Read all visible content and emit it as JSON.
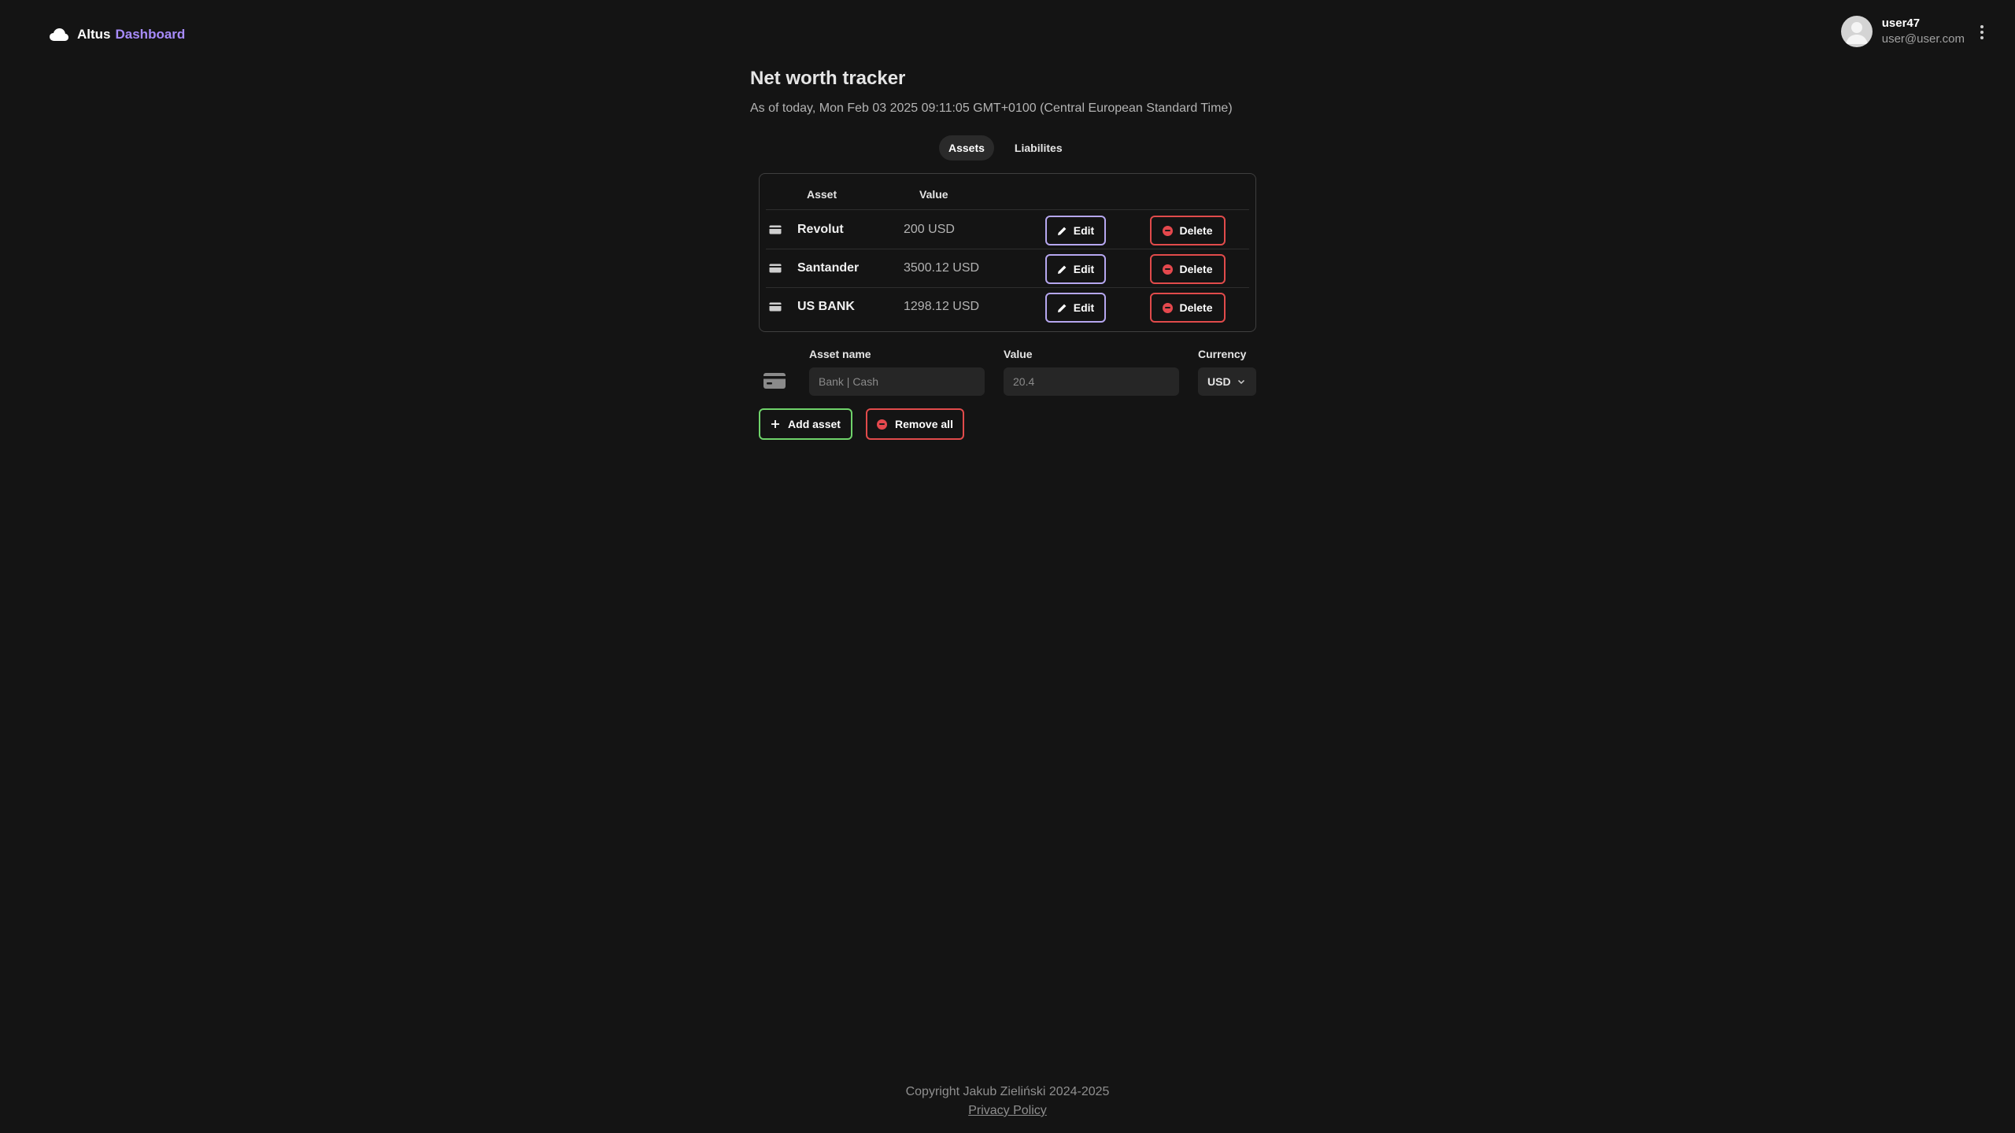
{
  "header": {
    "brand_name": "Altus",
    "brand_accent": "Dashboard",
    "user": {
      "name": "user47",
      "email": "user@user.com"
    }
  },
  "page": {
    "title": "Net worth tracker",
    "subtitle": "As of today, Mon Feb 03 2025 09:11:05 GMT+0100 (Central European Standard Time)"
  },
  "tabs": [
    {
      "label": "Assets",
      "active": true
    },
    {
      "label": "Liabilites",
      "active": false
    }
  ],
  "table": {
    "headers": {
      "asset": "Asset",
      "value": "Value"
    },
    "rows": [
      {
        "name": "Revolut",
        "value": "200 USD",
        "edit_label": "Edit",
        "delete_label": "Delete"
      },
      {
        "name": "Santander",
        "value": "3500.12 USD",
        "edit_label": "Edit",
        "delete_label": "Delete"
      },
      {
        "name": "US BANK",
        "value": "1298.12 USD",
        "edit_label": "Edit",
        "delete_label": "Delete"
      }
    ]
  },
  "form": {
    "asset_name_label": "Asset name",
    "asset_name_placeholder": "Bank | Cash",
    "value_label": "Value",
    "value_placeholder": "20.4",
    "currency_label": "Currency",
    "currency_value": "USD"
  },
  "actions": {
    "add_label": "Add asset",
    "remove_label": "Remove all"
  },
  "footer": {
    "copyright": "Copyright Jakub Zieliński 2024-2025",
    "privacy": "Privacy Policy"
  },
  "colors": {
    "background": "#141414",
    "accent": "#a78bfa",
    "edit_border": "#b6a7f0",
    "delete_border": "#e14b4b",
    "add_border": "#6fd36a"
  }
}
